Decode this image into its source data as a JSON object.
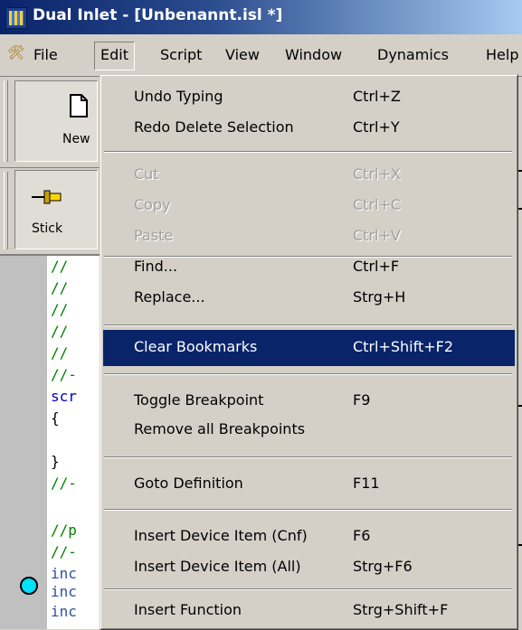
{
  "window": {
    "title": "Dual Inlet - [Unbenannt.isl *]"
  },
  "menubar": {
    "items": [
      {
        "label": "File"
      },
      {
        "label": "Edit"
      },
      {
        "label": "Script"
      },
      {
        "label": "View"
      },
      {
        "label": "Window"
      },
      {
        "label": "Dynamics"
      },
      {
        "label": "Help"
      }
    ]
  },
  "toolbar": {
    "new_label": "New",
    "stick_label": "Stick"
  },
  "editor": {
    "lines": [
      "//",
      "//",
      "//",
      "//",
      "//",
      "//-",
      "scr",
      "{",
      "",
      "}",
      "//-",
      "//p",
      "//-",
      "inc",
      "inc",
      "inc"
    ]
  },
  "edit_menu": {
    "items": [
      {
        "label": "Undo Typing",
        "shortcut": "Ctrl+Z",
        "enabled": true
      },
      {
        "label": "Redo Delete Selection",
        "shortcut": "Ctrl+Y",
        "enabled": true
      },
      {
        "label": "Cut",
        "shortcut": "Ctrl+X",
        "enabled": false
      },
      {
        "label": "Copy",
        "shortcut": "Ctrl+C",
        "enabled": false
      },
      {
        "label": "Paste",
        "shortcut": "Ctrl+V",
        "enabled": false
      },
      {
        "label": "Find...",
        "shortcut": "Ctrl+F",
        "enabled": true
      },
      {
        "label": "Replace...",
        "shortcut": "Strg+H",
        "enabled": true
      },
      {
        "label": "Clear Bookmarks",
        "shortcut": "Ctrl+Shift+F2",
        "enabled": true,
        "highlighted": true
      },
      {
        "label": "Toggle Breakpoint",
        "shortcut": "F9",
        "enabled": true
      },
      {
        "label": "Remove all Breakpoints",
        "shortcut": "",
        "enabled": true
      },
      {
        "label": "Goto Definition",
        "shortcut": "F11",
        "enabled": true
      },
      {
        "label": "Insert Device Item (Cnf)",
        "shortcut": "F6",
        "enabled": true
      },
      {
        "label": "Insert Device Item (All)",
        "shortcut": "Strg+F6",
        "enabled": true
      },
      {
        "label": "Insert Function",
        "shortcut": "Strg+Shift+F",
        "enabled": true
      }
    ]
  },
  "colors": {
    "title_bar": "#0a246a",
    "menu_highlight": "#0a246a",
    "menu_bg": "#d4d0c8",
    "comment": "#008000",
    "keyword": "#0000c0",
    "breakpoint": "#00e0ff"
  },
  "icons": {
    "app": "dual-inlet-app-icon",
    "file_menu": "file-menu-icon",
    "new": "new-document-icon",
    "stick": "pushpin-icon",
    "breakpoint": "breakpoint-marker-icon"
  }
}
